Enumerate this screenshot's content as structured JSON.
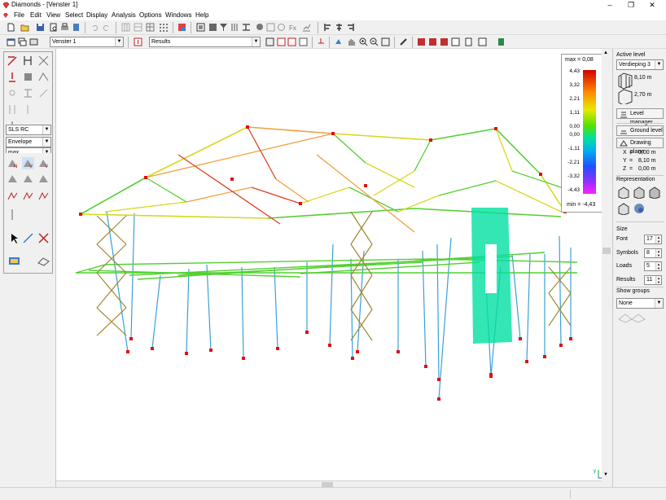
{
  "window": {
    "title": "Diamonds - [Venster 1]",
    "minimize": "–",
    "maximize": "❐",
    "close": "✕"
  },
  "menu": [
    "File",
    "Edit",
    "View",
    "Select",
    "Display",
    "Analysis",
    "Options",
    "Windows",
    "Help"
  ],
  "toolbar2": {
    "window_combo": "Venster 1",
    "results_combo": "Results"
  },
  "left_panel": {
    "load_combo": "SLS RC",
    "envelope_combo": "Envelope",
    "max_combo": "max"
  },
  "legend": {
    "max_label": "max = 0,08",
    "min_label": "min = -4,43",
    "ticks": [
      "4,43",
      "3,32",
      "2,21",
      "1,11",
      "0,00",
      "0,00",
      "-1,11",
      "-2,21",
      "-3,32",
      "-4,43"
    ]
  },
  "right_panel": {
    "active_level_title": "Active level",
    "level_combo": "Verdieping 3",
    "level_upper_value": "8,10 m",
    "level_lower_value": "2,70 m",
    "level_manager": "Level manager",
    "ground_level": "Ground level",
    "drawing_plane": "Drawing plane",
    "coords": [
      {
        "axis": "X",
        "value": "0,00 m"
      },
      {
        "axis": "Y",
        "value": "8,10 m"
      },
      {
        "axis": "Z",
        "value": "0,00 m"
      }
    ],
    "representation_title": "Representation",
    "size_title": "Size",
    "size_rows": [
      {
        "label": "Font",
        "value": "17"
      },
      {
        "label": "Symbols",
        "value": "8"
      },
      {
        "label": "Loads",
        "value": "5"
      },
      {
        "label": "Results",
        "value": "11"
      }
    ],
    "show_groups_title": "Show groups",
    "groups_combo": "None"
  },
  "axis_indicator": {
    "x": "x",
    "y": "y",
    "z": "z"
  }
}
